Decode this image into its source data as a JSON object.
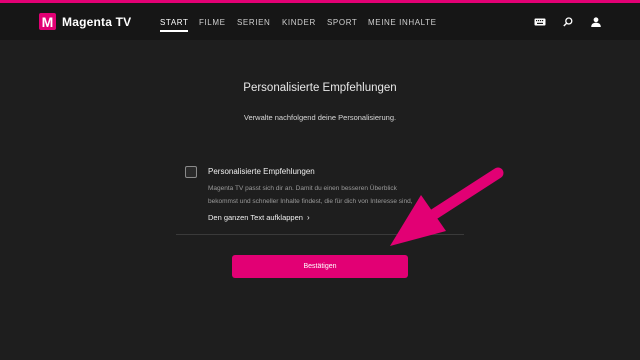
{
  "app": {
    "logo_letter": "M",
    "name": "Magenta TV",
    "accent": "#e20074"
  },
  "nav": {
    "items": [
      {
        "label": "START",
        "active": true
      },
      {
        "label": "FILME",
        "active": false
      },
      {
        "label": "SERIEN",
        "active": false
      },
      {
        "label": "KINDER",
        "active": false
      },
      {
        "label": "SPORT",
        "active": false
      },
      {
        "label": "MEINE INHALTE",
        "active": false
      }
    ]
  },
  "header_icons": [
    "keyboard-icon",
    "search-icon",
    "user-icon"
  ],
  "page": {
    "title": "Personalisierte Empfehlungen",
    "subtitle": "Verwalte nachfolgend deine Personalisierung."
  },
  "option": {
    "checked": false,
    "title": "Personalisierte Empfehlungen",
    "desc_line1": "Magenta TV passt sich dir an. Damit du einen besseren Überblick",
    "desc_line2": "bekommst und schneller Inhalte findest, die für dich von Interesse sind,",
    "expand_label": "Den ganzen Text aufklappen",
    "expand_chevron": "›"
  },
  "confirm_button": {
    "label": "Bestätigen"
  },
  "annotation": {
    "arrow_color": "#e20074",
    "arrow_icon": "arrow-pointer"
  }
}
